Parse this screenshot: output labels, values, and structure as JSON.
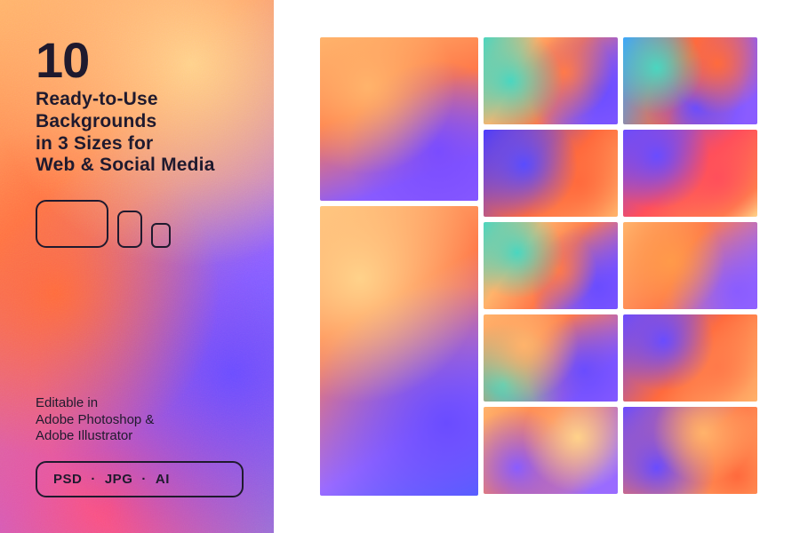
{
  "hero": {
    "count": "10",
    "headline_l1": "Ready-to-Use",
    "headline_l2": "Backgrounds",
    "headline_l3": "in 3 Sizes for",
    "headline_l4": "Web & Social Media",
    "editable_l1": "Editable in",
    "editable_l2": "Adobe Photoshop &",
    "editable_l3": "Adobe Illustrator",
    "formats": {
      "f1": "PSD",
      "f2": "JPG",
      "f3": "AI",
      "sep": "·"
    }
  },
  "thumbs": {
    "p1": "gradient-portrait-1",
    "p2": "gradient-portrait-2",
    "t1": "gradient-1",
    "t2": "gradient-2",
    "t3": "gradient-3",
    "t4": "gradient-4",
    "t5": "gradient-5",
    "t6": "gradient-6",
    "t7": "gradient-7",
    "t8": "gradient-8",
    "t9": "gradient-9",
    "t10": "gradient-10"
  }
}
